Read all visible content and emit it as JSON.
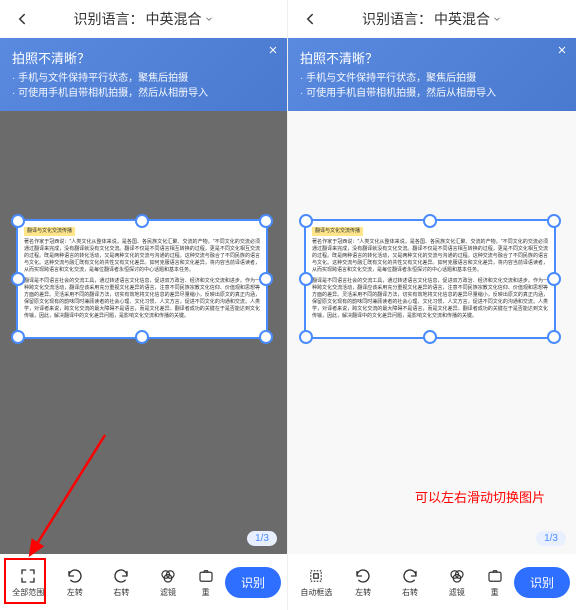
{
  "header": {
    "title_prefix": "识别语言：",
    "language": "中英混合"
  },
  "tip": {
    "title": "拍照不清晰？",
    "line1": "· 手机与文件保持平行状态，聚焦后拍摄",
    "line2": "· 可使用手机自带相机拍摄，然后从相册导入"
  },
  "document": {
    "title": "翻译与文化交流传播",
    "para1": "著名作家于冠西说：\"人类文化从整体来说，是各国、各民族文化汇聚、交流的产物。\"不同文化的交流必须通过翻译来完成，没有翻译就没有文化交流。翻译不仅是不同语言相互转换的过程，更是不同文化相互交流的过程。既是两种语言的转化活动，又是两种文化的交流与沟通的过程。这种交流与融合了不同民族的语言与文化。这种交流与融汇既有文化的共性又有文化差异。如何克服语言和文化差异，将内容当前译语读者，从而实现跨语言和文化交流，是每位翻译者永恒探讨的中心话题和基本任务。",
    "para2": "翻译是不同语言社会的交流工具，通过转述语言文化信息，促进双方政治、经济和文化交流和进步。作为一种跨文化交流活动，翻译应该采用充分重视文化差异的语言，注意不同民族宗教文化信仰、价值观和思想等方面的差异。灵活采用不同的翻译方法，切实有效地将文化信息的差异尽量缩小，反映出原文的真正内涵，保留原文化现有的韵味同时兼顾读者的社会心理、文化习惯、人文方言，促进不同文化的沟通和交流。人类学，对译者来说，跨文化交流的最大障碍不是语言，而是文化差异。翻译者成功的关键在于是否能达到文化传输，因此，解决翻译中的文化差异问题，是影响文化交流和传播的关键。"
  },
  "pageCounter": "1/3",
  "toolbar": {
    "left": {
      "fullscreen": "全部范围",
      "rotate_left": "左转",
      "rotate_right": "右转",
      "filter": "滤镜",
      "retake": "重"
    },
    "right": {
      "auto_select": "自动框选",
      "rotate_left": "左转",
      "rotate_right": "右转",
      "filter": "滤镜",
      "retake": "重"
    },
    "recognize": "识别"
  },
  "annotations": {
    "swipe_hint": "可以左右滑动切换图片"
  },
  "colors": {
    "primary": "#4a8cff",
    "banner": "#5a8ae0",
    "button": "#2f6fff",
    "annotation": "#ff0000"
  }
}
